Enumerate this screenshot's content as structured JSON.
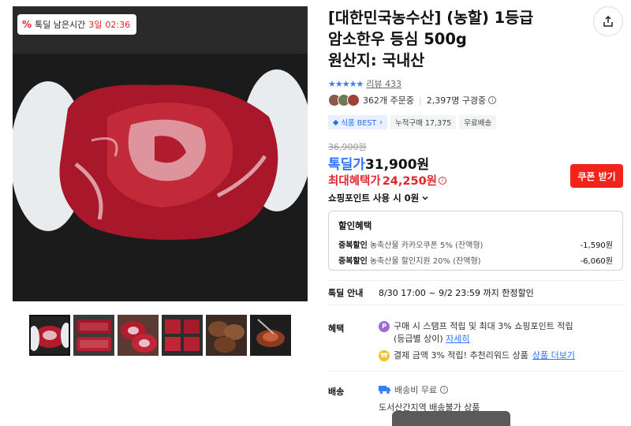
{
  "timer": {
    "prefix": "톡딜 남은시간",
    "days": "3일",
    "time": "02:36"
  },
  "product": {
    "title_line1": "[대한민국농수산] (농할) 1등급",
    "title_line2": "암소한우 등심 500g",
    "title_line3": "원산지: 국내산"
  },
  "rating": {
    "stars": "★★★★★",
    "reviews_label": "리뷰",
    "reviews_count": "433"
  },
  "social": {
    "orders": "362개 주문중",
    "watching": "2,397명 구경중"
  },
  "tags": {
    "best": "식품 BEST",
    "cumulative": "누적구매 17,375",
    "shipping": "무료배송"
  },
  "price": {
    "original": "36,900원",
    "deal_label": "톡딜가",
    "deal_price": "31,900원",
    "max_label": "최대혜택가",
    "max_price": "24,250원",
    "coupon_button": "쿠폰 받기",
    "points_toggle": "쇼핑포인트 사용 시 0원"
  },
  "discount": {
    "header": "할인혜택",
    "rows": [
      {
        "type": "중복할인",
        "desc": "농축산물 카카오쿠폰 5% (잔액형)",
        "amount": "-1,590원"
      },
      {
        "type": "중복할인",
        "desc": "농축산물 할인지원 20% (잔액형)",
        "amount": "-6,060원"
      }
    ]
  },
  "notice": {
    "label": "톡딜 안내",
    "text": "8/30 17:00 ~ 9/2 23:59 까지 한정할인"
  },
  "benefit": {
    "label": "혜택",
    "line1": "구매 시 스탬프 적립 및 최대 3% 쇼핑포인트 적립",
    "line1b": "(등급별 상이)",
    "line1_link": "자세히",
    "line2": "결제 금액 3% 적립! 추천리워드 상품",
    "line2_link": "상품 더보기"
  },
  "shipping": {
    "label": "배송",
    "fee": "배송비 무료",
    "note": "도서산간지역 배송불가 상품"
  },
  "colors": {
    "accent_blue": "#2d74ff",
    "accent_red": "#e3262c",
    "coupon_red": "#f1231b"
  }
}
